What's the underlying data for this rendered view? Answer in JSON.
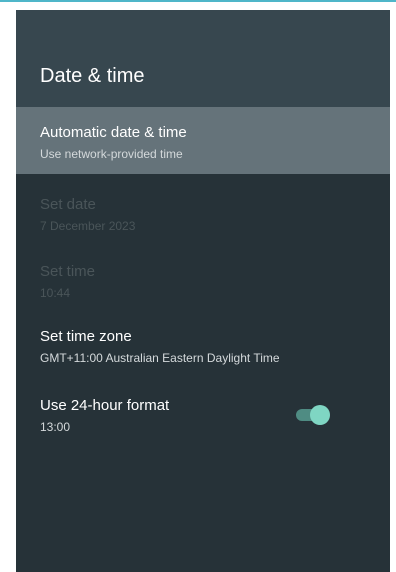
{
  "header": {
    "title": "Date & time"
  },
  "settings": {
    "automatic": {
      "label": "Automatic date & time",
      "value": "Use network-provided time",
      "enabled": true
    },
    "set_date": {
      "label": "Set date",
      "value": "7 December 2023",
      "enabled": false
    },
    "set_time": {
      "label": "Set time",
      "value": "10:44",
      "enabled": false
    },
    "time_zone": {
      "label": "Set time zone",
      "value": "GMT+11:00 Australian Eastern Daylight Time",
      "enabled": true
    },
    "hour_format": {
      "label": "Use 24-hour format",
      "value": "13:00",
      "enabled": true,
      "toggle_on": true
    }
  },
  "colors": {
    "background": "#263238",
    "header": "#37474f",
    "selected_row": "#65737a",
    "accent": "#7fd6c3"
  }
}
